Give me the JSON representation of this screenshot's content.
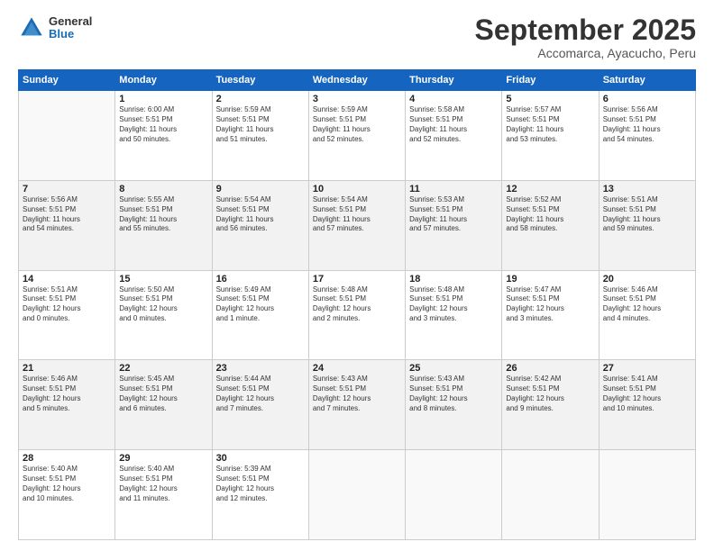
{
  "header": {
    "logo_line1": "General",
    "logo_line2": "Blue",
    "month": "September 2025",
    "location": "Accomarca, Ayacucho, Peru"
  },
  "weekdays": [
    "Sunday",
    "Monday",
    "Tuesday",
    "Wednesday",
    "Thursday",
    "Friday",
    "Saturday"
  ],
  "weeks": [
    [
      {
        "day": "",
        "info": ""
      },
      {
        "day": "1",
        "info": "Sunrise: 6:00 AM\nSunset: 5:51 PM\nDaylight: 11 hours\nand 50 minutes."
      },
      {
        "day": "2",
        "info": "Sunrise: 5:59 AM\nSunset: 5:51 PM\nDaylight: 11 hours\nand 51 minutes."
      },
      {
        "day": "3",
        "info": "Sunrise: 5:59 AM\nSunset: 5:51 PM\nDaylight: 11 hours\nand 52 minutes."
      },
      {
        "day": "4",
        "info": "Sunrise: 5:58 AM\nSunset: 5:51 PM\nDaylight: 11 hours\nand 52 minutes."
      },
      {
        "day": "5",
        "info": "Sunrise: 5:57 AM\nSunset: 5:51 PM\nDaylight: 11 hours\nand 53 minutes."
      },
      {
        "day": "6",
        "info": "Sunrise: 5:56 AM\nSunset: 5:51 PM\nDaylight: 11 hours\nand 54 minutes."
      }
    ],
    [
      {
        "day": "7",
        "info": "Sunrise: 5:56 AM\nSunset: 5:51 PM\nDaylight: 11 hours\nand 54 minutes."
      },
      {
        "day": "8",
        "info": "Sunrise: 5:55 AM\nSunset: 5:51 PM\nDaylight: 11 hours\nand 55 minutes."
      },
      {
        "day": "9",
        "info": "Sunrise: 5:54 AM\nSunset: 5:51 PM\nDaylight: 11 hours\nand 56 minutes."
      },
      {
        "day": "10",
        "info": "Sunrise: 5:54 AM\nSunset: 5:51 PM\nDaylight: 11 hours\nand 57 minutes."
      },
      {
        "day": "11",
        "info": "Sunrise: 5:53 AM\nSunset: 5:51 PM\nDaylight: 11 hours\nand 57 minutes."
      },
      {
        "day": "12",
        "info": "Sunrise: 5:52 AM\nSunset: 5:51 PM\nDaylight: 11 hours\nand 58 minutes."
      },
      {
        "day": "13",
        "info": "Sunrise: 5:51 AM\nSunset: 5:51 PM\nDaylight: 11 hours\nand 59 minutes."
      }
    ],
    [
      {
        "day": "14",
        "info": "Sunrise: 5:51 AM\nSunset: 5:51 PM\nDaylight: 12 hours\nand 0 minutes."
      },
      {
        "day": "15",
        "info": "Sunrise: 5:50 AM\nSunset: 5:51 PM\nDaylight: 12 hours\nand 0 minutes."
      },
      {
        "day": "16",
        "info": "Sunrise: 5:49 AM\nSunset: 5:51 PM\nDaylight: 12 hours\nand 1 minute."
      },
      {
        "day": "17",
        "info": "Sunrise: 5:48 AM\nSunset: 5:51 PM\nDaylight: 12 hours\nand 2 minutes."
      },
      {
        "day": "18",
        "info": "Sunrise: 5:48 AM\nSunset: 5:51 PM\nDaylight: 12 hours\nand 3 minutes."
      },
      {
        "day": "19",
        "info": "Sunrise: 5:47 AM\nSunset: 5:51 PM\nDaylight: 12 hours\nand 3 minutes."
      },
      {
        "day": "20",
        "info": "Sunrise: 5:46 AM\nSunset: 5:51 PM\nDaylight: 12 hours\nand 4 minutes."
      }
    ],
    [
      {
        "day": "21",
        "info": "Sunrise: 5:46 AM\nSunset: 5:51 PM\nDaylight: 12 hours\nand 5 minutes."
      },
      {
        "day": "22",
        "info": "Sunrise: 5:45 AM\nSunset: 5:51 PM\nDaylight: 12 hours\nand 6 minutes."
      },
      {
        "day": "23",
        "info": "Sunrise: 5:44 AM\nSunset: 5:51 PM\nDaylight: 12 hours\nand 7 minutes."
      },
      {
        "day": "24",
        "info": "Sunrise: 5:43 AM\nSunset: 5:51 PM\nDaylight: 12 hours\nand 7 minutes."
      },
      {
        "day": "25",
        "info": "Sunrise: 5:43 AM\nSunset: 5:51 PM\nDaylight: 12 hours\nand 8 minutes."
      },
      {
        "day": "26",
        "info": "Sunrise: 5:42 AM\nSunset: 5:51 PM\nDaylight: 12 hours\nand 9 minutes."
      },
      {
        "day": "27",
        "info": "Sunrise: 5:41 AM\nSunset: 5:51 PM\nDaylight: 12 hours\nand 10 minutes."
      }
    ],
    [
      {
        "day": "28",
        "info": "Sunrise: 5:40 AM\nSunset: 5:51 PM\nDaylight: 12 hours\nand 10 minutes."
      },
      {
        "day": "29",
        "info": "Sunrise: 5:40 AM\nSunset: 5:51 PM\nDaylight: 12 hours\nand 11 minutes."
      },
      {
        "day": "30",
        "info": "Sunrise: 5:39 AM\nSunset: 5:51 PM\nDaylight: 12 hours\nand 12 minutes."
      },
      {
        "day": "",
        "info": ""
      },
      {
        "day": "",
        "info": ""
      },
      {
        "day": "",
        "info": ""
      },
      {
        "day": "",
        "info": ""
      }
    ]
  ]
}
